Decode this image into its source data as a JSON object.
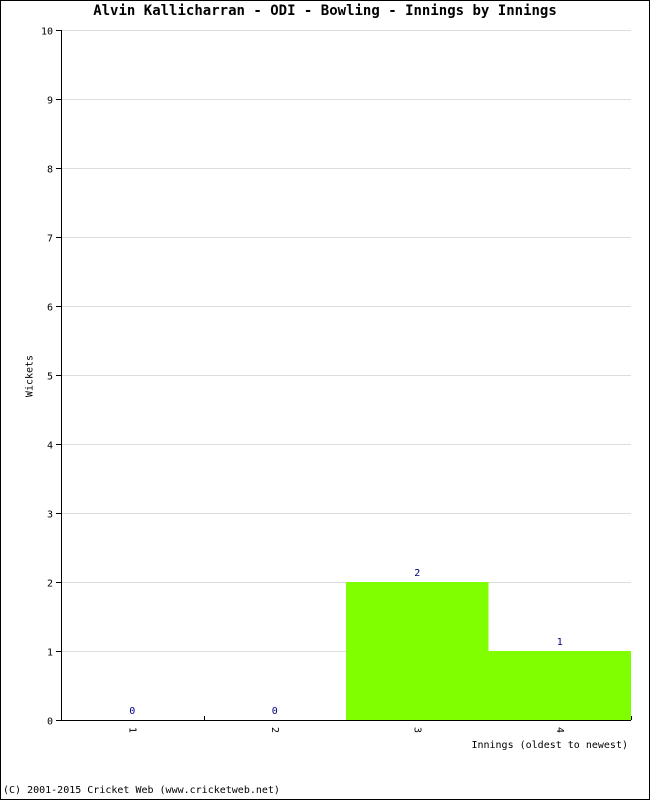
{
  "chart_data": {
    "type": "bar",
    "title": "Alvin Kallicharran - ODI - Bowling - Innings by Innings",
    "xlabel": "Innings (oldest to newest)",
    "ylabel": "Wickets",
    "categories": [
      "1",
      "2",
      "3",
      "4"
    ],
    "values": [
      0,
      0,
      2,
      1
    ],
    "ylim": [
      0,
      10
    ],
    "yticks": [
      0,
      1,
      2,
      3,
      4,
      5,
      6,
      7,
      8,
      9,
      10
    ],
    "grid": true,
    "bar_color": "#7fff00",
    "label_color": "#000080",
    "grid_color": "#dddddd"
  },
  "footer": "(C) 2001-2015 Cricket Web (www.cricketweb.net)"
}
